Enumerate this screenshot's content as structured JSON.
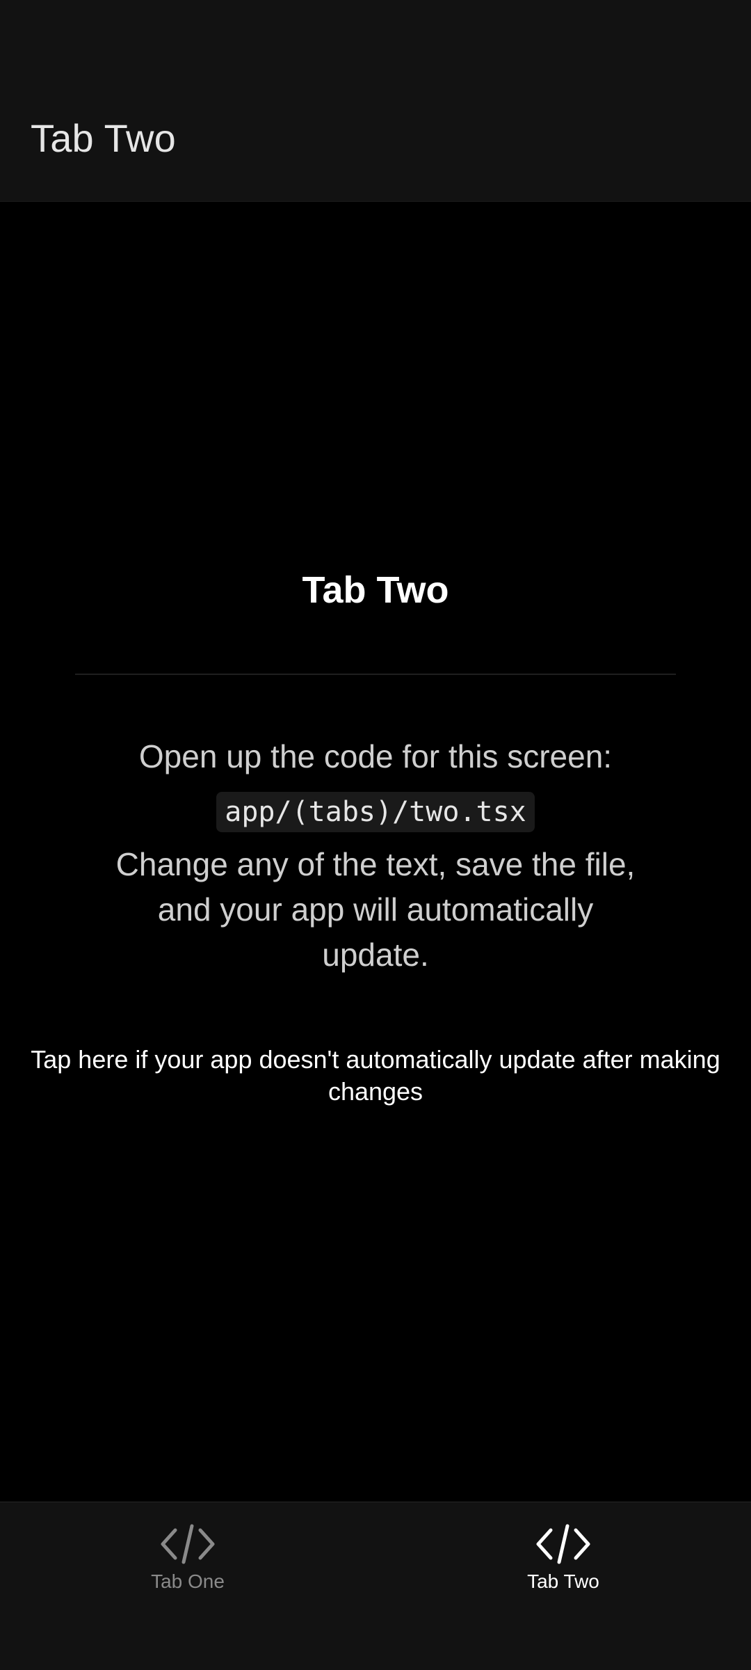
{
  "header": {
    "title": "Tab Two"
  },
  "main": {
    "title": "Tab Two",
    "instructions": "Open up the code for this screen:",
    "code_path": "app/(tabs)/two.tsx",
    "change_text": "Change any of the text, save the file, and your app will automatically update.",
    "help_link": "Tap here if your app doesn't automatically update after making changes"
  },
  "tabbar": {
    "tabs": [
      {
        "label": "Tab One",
        "icon": "code-icon",
        "active": false
      },
      {
        "label": "Tab Two",
        "icon": "code-icon",
        "active": true
      }
    ]
  },
  "colors": {
    "background": "#000000",
    "header_background": "#121212",
    "tab_active": "#ffffff",
    "tab_inactive": "#8a8a8a",
    "text_secondary": "#cfcfcf"
  }
}
